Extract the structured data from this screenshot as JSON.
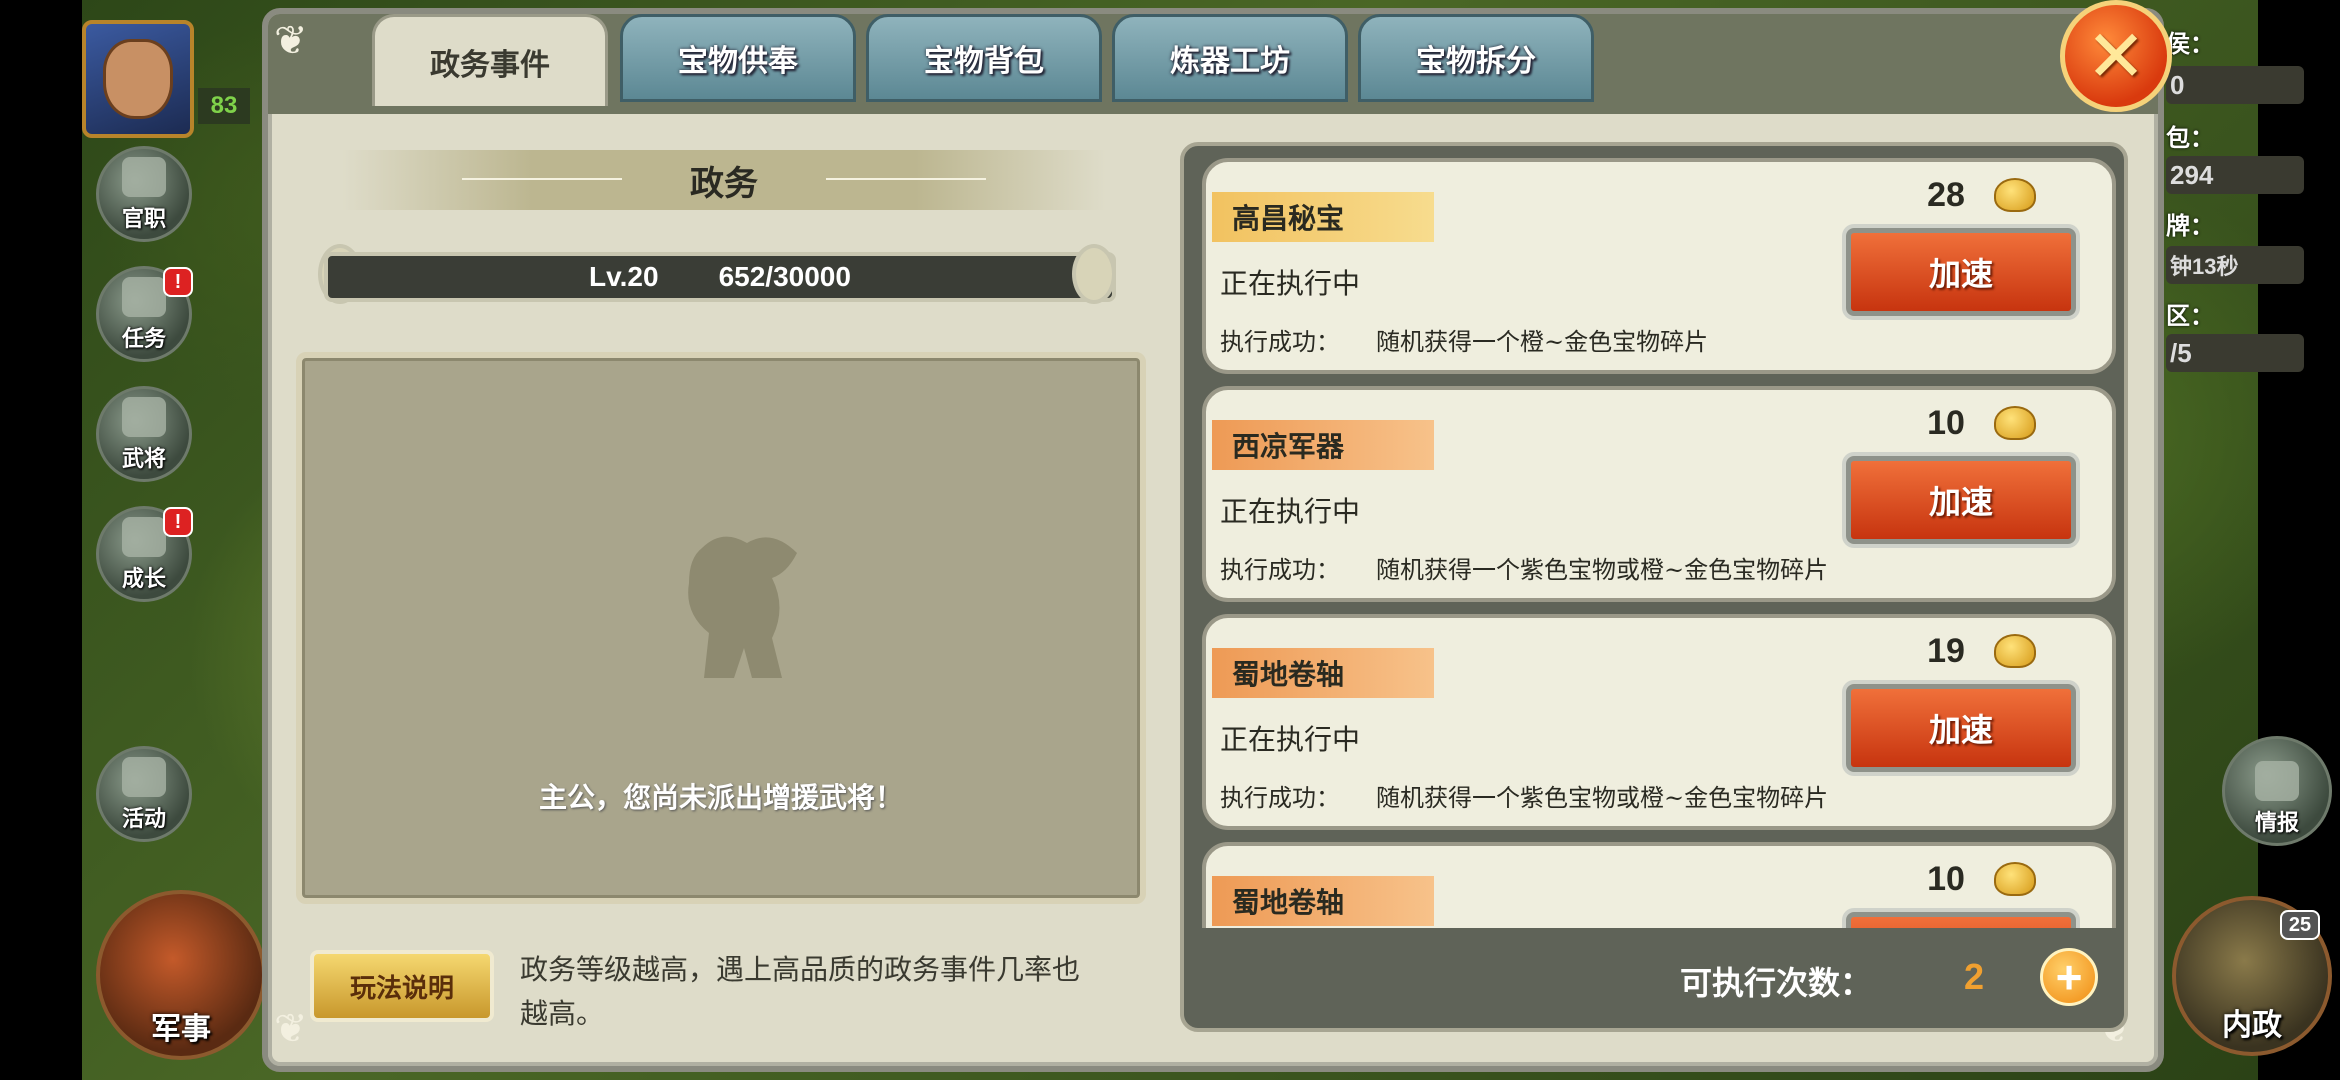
{
  "hud": {
    "player_level": "83",
    "left_buttons": [
      {
        "label": "官职",
        "badge": ""
      },
      {
        "label": "任务",
        "badge": "!"
      },
      {
        "label": "武将",
        "badge": ""
      },
      {
        "label": "成长",
        "badge": "!"
      },
      {
        "label": "活动",
        "badge": ""
      }
    ],
    "military_label": "军事",
    "right_labels": [
      "侯：",
      "包：",
      "牌：",
      "区："
    ],
    "right_values": [
      "0",
      "294",
      "钟13秒",
      "/5"
    ],
    "intel_label": "情报",
    "domestic_label": "内政",
    "domestic_badge": "25"
  },
  "tabs": [
    {
      "label": "政务事件",
      "active": true
    },
    {
      "label": "宝物供奉",
      "active": false
    },
    {
      "label": "宝物背包",
      "active": false
    },
    {
      "label": "炼器工坊",
      "active": false
    },
    {
      "label": "宝物拆分",
      "active": false
    }
  ],
  "close_label": "✕",
  "section_title": "政务",
  "level": {
    "label": "Lv.20",
    "progress": "652/30000",
    "current": 652,
    "max": 30000
  },
  "empty_message": "主公，您尚未派出增援武将！",
  "help_button": "玩法说明",
  "help_text": "政务等级越高，遇上高品质的政务事件几率也越高。",
  "tasks": [
    {
      "name": "高昌秘宝",
      "cost": "28",
      "status": "正在执行中",
      "result_label": "执行成功：",
      "result_text": "随机获得一个橙~金色宝物碎片",
      "button": "加速",
      "ribbon": "gold"
    },
    {
      "name": "西凉军器",
      "cost": "10",
      "status": "正在执行中",
      "result_label": "执行成功：",
      "result_text": "随机获得一个紫色宝物或橙~金色宝物碎片",
      "button": "加速",
      "ribbon": "orange"
    },
    {
      "name": "蜀地卷轴",
      "cost": "19",
      "status": "正在执行中",
      "result_label": "执行成功：",
      "result_text": "随机获得一个紫色宝物或橙~金色宝物碎片",
      "button": "加速",
      "ribbon": "orange"
    },
    {
      "name": "蜀地卷轴",
      "cost": "10",
      "status": "",
      "result_label": "",
      "result_text": "",
      "button": "",
      "ribbon": "orange"
    }
  ],
  "exec_label": "可执行次数：",
  "exec_value": "2",
  "colors": {
    "accent": "#d93a0e",
    "panel": "#dedcc9",
    "tab": "#6f98a3",
    "gold": "#f0a030"
  }
}
